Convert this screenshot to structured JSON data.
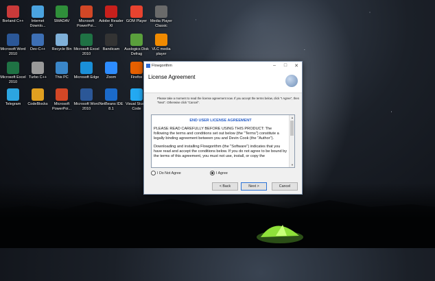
{
  "desktop_icons": [
    {
      "label": "Borland C++",
      "name": "borland-cpp-icon",
      "color": "#c93a3a"
    },
    {
      "label": "Internet Downlo...",
      "name": "internet-download-icon",
      "color": "#4aa3df"
    },
    {
      "label": "SMADAV",
      "name": "smadav-icon",
      "color": "#2f8f3a"
    },
    {
      "label": "Microsoft PowerPoi...",
      "name": "powerpoint-icon",
      "color": "#d24726"
    },
    {
      "label": "Adobe Reader XI",
      "name": "adobe-reader-icon",
      "color": "#c8201c"
    },
    {
      "label": "GOM Player",
      "name": "gom-player-icon",
      "color": "#e8432f"
    },
    {
      "label": "Media Player Classic",
      "name": "media-player-classic-icon",
      "color": "#6a6a6a"
    },
    {
      "label": "Microsoft Word 2010",
      "name": "word-icon",
      "color": "#2b5797"
    },
    {
      "label": "Dev-C++",
      "name": "devcpp-icon",
      "color": "#3d6fb4"
    },
    {
      "label": "Recycle Bin",
      "name": "recycle-bin-icon",
      "color": "#7fb0d8"
    },
    {
      "label": "Microsoft Excel 2010",
      "name": "excel-icon",
      "color": "#1f7244"
    },
    {
      "label": "Bandicam",
      "name": "bandicam-icon",
      "color": "#333333"
    },
    {
      "label": "Auslogics Disk Defrag",
      "name": "disk-defrag-icon",
      "color": "#5a9f3c"
    },
    {
      "label": "VLC media player",
      "name": "vlc-icon",
      "color": "#f08a00"
    },
    {
      "label": "Microsoft Excel 2010",
      "name": "excel-icon",
      "color": "#1f7244"
    },
    {
      "label": "Turbo C++",
      "name": "turbo-cpp-icon",
      "color": "#9a9a9a"
    },
    {
      "label": "This PC",
      "name": "this-pc-icon",
      "color": "#3a86c8"
    },
    {
      "label": "Microsoft Edge",
      "name": "edge-icon",
      "color": "#1a8fd8"
    },
    {
      "label": "Zoom",
      "name": "zoom-icon",
      "color": "#2d8cff"
    },
    {
      "label": "Firefox",
      "name": "firefox-icon",
      "color": "#e66000"
    },
    {
      "label": "Telegram",
      "name": "telegram-icon",
      "color": "#2ca5e0"
    },
    {
      "label": "CodeBlocks",
      "name": "codeblocks-icon",
      "color": "#e0a020"
    },
    {
      "label": "Microsoft PowerPoi...",
      "name": "powerpoint-icon",
      "color": "#d24726"
    },
    {
      "label": "Microsoft Word 2010",
      "name": "word-icon",
      "color": "#2b5797"
    },
    {
      "label": "NetBeans IDE 8.1",
      "name": "netbeans-icon",
      "color": "#1b6ac9"
    },
    {
      "label": "Visual Studio Code",
      "name": "vscode-icon",
      "color": "#23a9f2"
    }
  ],
  "dialog": {
    "window_title": "Flowgorithm",
    "minimize": "–",
    "maximize": "□",
    "close": "✕",
    "header_title": "License Agreement",
    "intro": "Please take a moment to read the license agreement now. If you accept the terms below, click \"I Agree\", then \"Next\". Otherwise click \"Cancel\".",
    "eula_heading": "END USER LICENSE AGREEMENT",
    "eula_p1": "PLEASE READ CAREFULLY BEFORE USING THIS PRODUCT:  The following the terms and conditions set out below (the \"Terms\") constitute a legally binding agreement between you and Devin Cook (the \"Author\").",
    "eula_p2": "Downloading and installing Flowgorithm (the \"Software\") indicates that you have read and accept the conditions below. If you do not agree to be bound by the terms of this agreement, you must not use, install, or copy the",
    "radio_disagree": "I Do Not Agree",
    "radio_agree": "I Agree",
    "selected": "I Agree",
    "btn_back": "< Back",
    "btn_next": "Next >",
    "btn_cancel": "Cancel"
  }
}
